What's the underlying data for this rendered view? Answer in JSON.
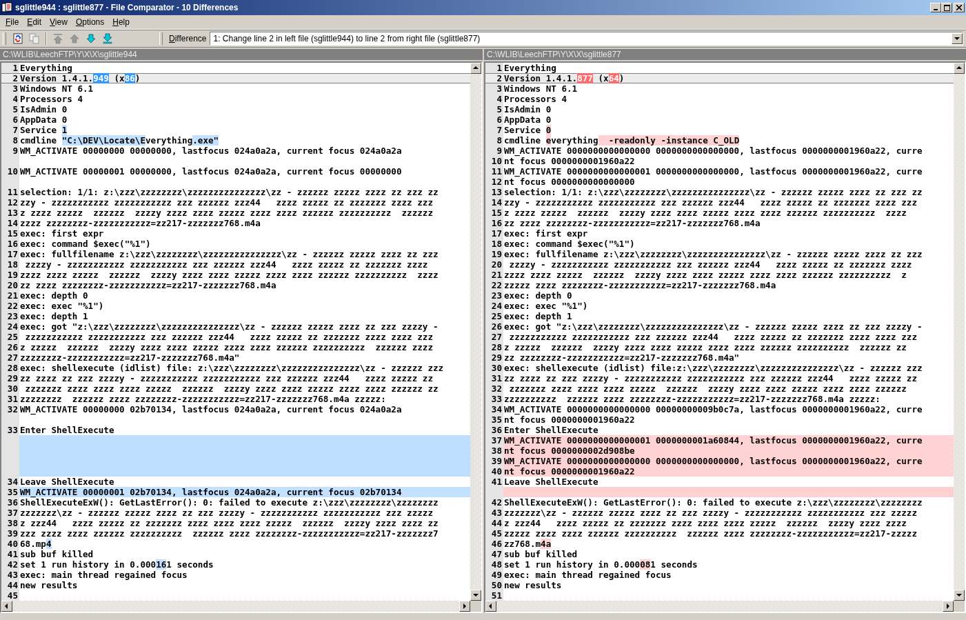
{
  "window": {
    "title": "sglittle944 : sglittle877 - File Comparator - 10 Differences"
  },
  "menu": [
    "File",
    "Edit",
    "View",
    "Options",
    "Help"
  ],
  "toolbar_buttons": [
    {
      "disabled": false
    },
    {
      "disabled": true
    },
    {
      "disabled": true
    },
    {
      "disabled": true
    },
    {
      "disabled": false
    },
    {
      "disabled": false
    }
  ],
  "difference": {
    "label": "Difference",
    "value": "1: Change line 2 in left file (sglittle944) to line 2 from right file (sglittle877)"
  },
  "panes": [
    {
      "color": "#3399ff",
      "path": "C:\\WLIB\\LeechFTP\\Y\\X\\X\\sglittle944",
      "rows": [
        {
          "kind": "line",
          "number": "1",
          "text": "Everything"
        },
        {
          "kind": "line",
          "number": "2",
          "current": true,
          "parts": [
            {
              "text": "Version 1.4.1."
            },
            {
              "text": "949",
              "changed": true
            },
            {
              "text": " (x"
            },
            {
              "text": "86",
              "changed": true
            },
            {
              "text": ")"
            }
          ]
        },
        {
          "kind": "line",
          "number": "3",
          "text": "Windows NT 6.1"
        },
        {
          "kind": "line",
          "number": "4",
          "text": "Processors 4"
        },
        {
          "kind": "line",
          "number": "5",
          "text": "IsAdmin 0"
        },
        {
          "kind": "line",
          "number": "6",
          "text": "AppData 0"
        },
        {
          "kind": "line",
          "number": "7",
          "parts": [
            {
              "text": "Service "
            },
            {
              "text": "1",
              "changed": true
            }
          ]
        },
        {
          "kind": "line",
          "number": "8",
          "parts": [
            {
              "text": "cmdline "
            },
            {
              "text": "\"C:\\DEV\\Locate\\E",
              "changed": true
            },
            {
              "text": "verything"
            },
            {
              "text": ".exe\"",
              "changed": true
            }
          ]
        },
        {
          "kind": "line",
          "number": "9",
          "text": "WM_ACTIVATE 00000000 00000000, lastfocus 024a0a2a, current focus 024a0a2a"
        },
        {
          "kind": "blank"
        },
        {
          "kind": "line",
          "number": "10",
          "text": "WM_ACTIVATE 00000001 00000000, lastfocus 024a0a2a, current focus 00000000"
        },
        {
          "kind": "blank"
        },
        {
          "kind": "line",
          "number": "11",
          "text": "selection: 1/1: z:\\zzz\\zzzzzzzz\\zzzzzzzzzzzzzzz\\zz - zzzzzz zzzzz zzzz zz zzz zz"
        },
        {
          "kind": "line",
          "number": "12",
          "text": "zzy - zzzzzzzzzzz zzzzzzzzzzz zzz zzzzzz zzz44   zzzz zzzzz zz zzzzzzz zzzz zzz"
        },
        {
          "kind": "line",
          "number": "13",
          "text": "z zzzz zzzzz  zzzzzz  zzzzy zzzz zzzz zzzzz zzzz zzzz zzzzzz zzzzzzzzzz  zzzzzz"
        },
        {
          "kind": "line",
          "number": "14",
          "text": "zzzz zzzzzzzz-zzzzzzzzzzz=zz217-zzzzzzz768.m4a"
        },
        {
          "kind": "line",
          "number": "15",
          "text": "exec: first expr"
        },
        {
          "kind": "line",
          "number": "16",
          "text": "exec: command $exec(\"%1\")"
        },
        {
          "kind": "line",
          "number": "17",
          "text": "exec: fullfilename z:\\zzz\\zzzzzzzz\\zzzzzzzzzzzzzzz\\zz - zzzzzz zzzzz zzzz zz zzz"
        },
        {
          "kind": "line",
          "number": "18",
          "text": " zzzzy - zzzzzzzzzzz zzzzzzzzzzz zzz zzzzzz zzz44   zzzz zzzzz zz zzzzzzz zzzz"
        },
        {
          "kind": "line",
          "number": "19",
          "text": "zzzz zzzz zzzzz  zzzzzz  zzzzy zzzz zzzz zzzzz zzzz zzzz zzzzzz zzzzzzzzzz  zzzz"
        },
        {
          "kind": "line",
          "number": "20",
          "text": "zz zzzz zzzzzzzz-zzzzzzzzzzz=zz217-zzzzzzz768.m4a"
        },
        {
          "kind": "line",
          "number": "21",
          "text": "exec: depth 0"
        },
        {
          "kind": "line",
          "number": "22",
          "text": "exec: exec \"%1\")"
        },
        {
          "kind": "line",
          "number": "23",
          "text": "exec: depth 1"
        },
        {
          "kind": "line",
          "number": "24",
          "text": "exec: got \"z:\\zzz\\zzzzzzzz\\zzzzzzzzzzzzzzz\\zz - zzzzzz zzzzz zzzz zz zzz zzzzy -"
        },
        {
          "kind": "line",
          "number": "25",
          "text": " zzzzzzzzzzz zzzzzzzzzzz zzz zzzzzz zzz44   zzzz zzzzz zz zzzzzzz zzzz zzzz zzz"
        },
        {
          "kind": "line",
          "number": "26",
          "text": "z zzzzz  zzzzzz  zzzzy zzzz zzzz zzzzz zzzz zzzz zzzzzz zzzzzzzzzz  zzzzzz zzzz"
        },
        {
          "kind": "line",
          "number": "27",
          "text": "zzzzzzzz-zzzzzzzzzzz=zz217-zzzzzzz768.m4a\""
        },
        {
          "kind": "line",
          "number": "28",
          "text": "exec: shellexecute (idlist) file: z:\\zzz\\zzzzzzzz\\zzzzzzzzzzzzzzz\\zz - zzzzzz zzz"
        },
        {
          "kind": "line",
          "number": "29",
          "text": "zz zzzz zz zzz zzzzy - zzzzzzzzzzz zzzzzzzzzzz zzz zzzzzz zzz44   zzzz zzzzz zz"
        },
        {
          "kind": "line",
          "number": "30",
          "text": " zzzzzzz zzzz zzzz zzzz zzzzz  zzzzzz  zzzzy zzzz zzzz zzzzz zzzz zzzz zzzzzz zz"
        },
        {
          "kind": "line",
          "number": "31",
          "text": "zzzzzzzz  zzzzzz zzzz zzzzzzzz-zzzzzzzzzzz=zz217-zzzzzzz768.m4a zzzzz:"
        },
        {
          "kind": "line",
          "number": "32",
          "text": "WM_ACTIVATE 00000000 02b70134, lastfocus 024a0a2a, current focus 024a0a2a"
        },
        {
          "kind": "blank"
        },
        {
          "kind": "line",
          "number": "33",
          "text": "Enter ShellExecute"
        },
        {
          "kind": "gap"
        },
        {
          "kind": "gap"
        },
        {
          "kind": "gap"
        },
        {
          "kind": "gap"
        },
        {
          "kind": "line",
          "number": "34",
          "text": "Leave ShellExecute"
        },
        {
          "kind": "line",
          "number": "35",
          "changed": true,
          "text": "WM_ACTIVATE 00000001 02b70134, lastfocus 024a0a2a, current focus 02b70134"
        },
        {
          "kind": "line",
          "number": "36",
          "text": "ShellExecuteExW(): GetLastError(): 0: failed to execute z:\\zzz\\zzzzzzzz\\zzzzzzzz"
        },
        {
          "kind": "line",
          "number": "37",
          "text": "zzzzzzz\\zz - zzzzzz zzzzz zzzz zz zzz zzzzy - zzzzzzzzzzz zzzzzzzzzzz zzz zzzzz"
        },
        {
          "kind": "line",
          "number": "38",
          "text": "z zzz44   zzzz zzzzz zz zzzzzzz zzzz zzzz zzzz zzzzz  zzzzzz  zzzzy zzzz zzzz zz"
        },
        {
          "kind": "line",
          "number": "39",
          "text": "zzz zzzz zzzz zzzzzz zzzzzzzzzz  zzzzzz zzzz zzzzzzzz-zzzzzzzzzzz=zz217-zzzzzzz7"
        },
        {
          "kind": "line",
          "number": "40",
          "parts": [
            {
              "text": "68.mp"
            },
            {
              "text": "4",
              "changed": true
            }
          ]
        },
        {
          "kind": "line",
          "number": "41",
          "text": "sub buf killed"
        },
        {
          "kind": "line",
          "number": "42",
          "parts": [
            {
              "text": "set 1 run history in 0.000"
            },
            {
              "text": "16",
              "changed": true
            },
            {
              "text": "1 seconds"
            }
          ]
        },
        {
          "kind": "line",
          "number": "43",
          "text": "exec: main thread regained focus"
        },
        {
          "kind": "line",
          "number": "44",
          "text": "new results"
        },
        {
          "kind": "line",
          "number": "45"
        }
      ]
    },
    {
      "color": "#ff6b6b",
      "path": "C:\\WLIB\\LeechFTP\\Y\\X\\X\\sglittle877",
      "rows": [
        {
          "kind": "line",
          "number": "1",
          "text": "Everything"
        },
        {
          "kind": "line",
          "number": "2",
          "current": true,
          "parts": [
            {
              "text": "Version 1.4.1."
            },
            {
              "text": "877",
              "changed": true
            },
            {
              "text": " (x"
            },
            {
              "text": "64",
              "changed": true
            },
            {
              "text": ")"
            }
          ]
        },
        {
          "kind": "line",
          "number": "3",
          "text": "Windows NT 6.1"
        },
        {
          "kind": "line",
          "number": "4",
          "text": "Processors 4"
        },
        {
          "kind": "line",
          "number": "5",
          "text": "IsAdmin 0"
        },
        {
          "kind": "line",
          "number": "6",
          "text": "AppData 0"
        },
        {
          "kind": "line",
          "number": "7",
          "parts": [
            {
              "text": "Service "
            },
            {
              "text": "0",
              "changed": true
            }
          ]
        },
        {
          "kind": "line",
          "number": "8",
          "parts": [
            {
              "text": "cmdline "
            },
            {
              "text": "e",
              "changed": true
            },
            {
              "text": "verything"
            },
            {
              "text": "  -readonly -instance C_OLD",
              "changed": true
            }
          ]
        },
        {
          "kind": "line",
          "number": "9",
          "text": "WM_ACTIVATE 0000000000000000 0000000000000000, lastfocus 0000000001960a22, curre"
        },
        {
          "kind": "line",
          "number": "10",
          "text": "nt focus 0000000001960a22"
        },
        {
          "kind": "line",
          "number": "11",
          "text": "WM_ACTIVATE 0000000000000001 0000000000000000, lastfocus 0000000001960a22, curre"
        },
        {
          "kind": "line",
          "number": "12",
          "text": "nt focus 0000000000000000"
        },
        {
          "kind": "line",
          "number": "13",
          "text": "selection: 1/1: z:\\zzz\\zzzzzzzz\\zzzzzzzzzzzzzzz\\zz - zzzzzz zzzzz zzzz zz zzz zz"
        },
        {
          "kind": "line",
          "number": "14",
          "text": "zzy - zzzzzzzzzzz zzzzzzzzzzz zzz zzzzzz zzz44   zzzz zzzzz zz zzzzzzz zzzz zzz"
        },
        {
          "kind": "line",
          "number": "15",
          "text": "z zzzz zzzzz  zzzzzz  zzzzy zzzz zzzz zzzzz zzzz zzzz zzzzzz zzzzzzzzzz  zzzz"
        },
        {
          "kind": "line",
          "number": "16",
          "text": "zz zzzz zzzzzzzz-zzzzzzzzzzz=zz217-zzzzzzz768.m4a"
        },
        {
          "kind": "line",
          "number": "17",
          "text": "exec: first expr"
        },
        {
          "kind": "line",
          "number": "18",
          "text": "exec: command $exec(\"%1\")"
        },
        {
          "kind": "line",
          "number": "19",
          "text": "exec: fullfilename z:\\zzz\\zzzzzzzz\\zzzzzzzzzzzzzzz\\zz - zzzzzz zzzzz zzzz zz zzz"
        },
        {
          "kind": "line",
          "number": "20",
          "text": " zzzzy - zzzzzzzzzzz zzzzzzzzzzz zzz zzzzzz zzz44   zzzz zzzzz zz zzzzzzz zzzz"
        },
        {
          "kind": "line",
          "number": "21",
          "text": "zzzz zzzz zzzzz  zzzzzz  zzzzy zzzz zzzz zzzzz zzzz zzzz zzzzzz zzzzzzzzzz  z"
        },
        {
          "kind": "line",
          "number": "22",
          "text": "zzzzz zzzz zzzzzzzz-zzzzzzzzzzz=zz217-zzzzzzz768.m4a"
        },
        {
          "kind": "line",
          "number": "23",
          "text": "exec: depth 0"
        },
        {
          "kind": "line",
          "number": "24",
          "text": "exec: exec \"%1\")"
        },
        {
          "kind": "line",
          "number": "25",
          "text": "exec: depth 1"
        },
        {
          "kind": "line",
          "number": "26",
          "text": "exec: got \"z:\\zzz\\zzzzzzzz\\zzzzzzzzzzzzzzz\\zz - zzzzzz zzzzz zzzz zz zzz zzzzy -"
        },
        {
          "kind": "line",
          "number": "27",
          "text": " zzzzzzzzzzz zzzzzzzzzzz zzz zzzzzz zzz44   zzzz zzzzz zz zzzzzzz zzzz zzzz zzz"
        },
        {
          "kind": "line",
          "number": "28",
          "text": "z zzzzz  zzzzzz  zzzzy zzzz zzzz zzzzz zzzz zzzz zzzzzz zzzzzzzzzz  zzzzzz zz"
        },
        {
          "kind": "line",
          "number": "29",
          "text": "zz zzzzzzzz-zzzzzzzzzzz=zz217-zzzzzzz768.m4a\""
        },
        {
          "kind": "line",
          "number": "30",
          "text": "exec: shellexecute (idlist) file:z:\\zzz\\zzzzzzzz\\zzzzzzzzzzzzzzz\\zz - zzzzzz zzz"
        },
        {
          "kind": "line",
          "number": "31",
          "text": "zz zzzz zz zzz zzzzy - zzzzzzzzzzz zzzzzzzzzzz zzz zzzzzz zzz44   zzzz zzzzz zz"
        },
        {
          "kind": "line",
          "number": "32",
          "text": " zzzzzzz zzzz zzzz zzzz zzzzz  zzzzzz  zzzzy zzzz zzzz zzzzz zzzz zzzz zzzzzz"
        },
        {
          "kind": "line",
          "number": "33",
          "text": "zzzzzzzzzz  zzzzzz zzzz zzzzzzzz-zzzzzzzzzzz=zz217-zzzzzzz768.m4a zzzzz:"
        },
        {
          "kind": "line",
          "number": "34",
          "text": "WM_ACTIVATE 0000000000000000 00000000009b0c7a, lastfocus 0000000001960a22, curre"
        },
        {
          "kind": "line",
          "number": "35",
          "text": "nt focus 0000000001960a22"
        },
        {
          "kind": "line",
          "number": "36",
          "text": "Enter ShellExecute"
        },
        {
          "kind": "line",
          "number": "37",
          "changed": true,
          "text": "WM_ACTIVATE 0000000000000001 0000000001a60844, lastfocus 0000000001960a22, curre"
        },
        {
          "kind": "line",
          "number": "38",
          "changed": true,
          "text": "nt focus 0000000002d908be"
        },
        {
          "kind": "line",
          "number": "39",
          "changed": true,
          "text": "WM_ACTIVATE 0000000000000000 0000000000000000, lastfocus 0000000001960a22, curre"
        },
        {
          "kind": "line",
          "number": "40",
          "changed": true,
          "text": "nt focus 0000000001960a22"
        },
        {
          "kind": "line",
          "number": "41",
          "text": "Leave ShellExecute"
        },
        {
          "kind": "gap"
        },
        {
          "kind": "line",
          "number": "42",
          "text": "ShellExecuteExW(): GetLastError(): 0: failed to execute z:\\zzz\\zzzzzzzz\\zzzzzzzz"
        },
        {
          "kind": "line",
          "number": "43",
          "text": "zzzzzzz\\zz - zzzzzz zzzzz zzzz zz zzz zzzzy - zzzzzzzzzzz zzzzzzzzzzz zzz zzzzz"
        },
        {
          "kind": "line",
          "number": "44",
          "text": "z zzz44   zzzz zzzzz zz zzzzzzz zzzz zzzz zzzz zzzzz  zzzzzz  zzzzy zzzz zzzz"
        },
        {
          "kind": "line",
          "number": "45",
          "text": "zzzzz zzzz zzzz zzzzzz zzzzzzzzzz  zzzzzz zzzz zzzzzzzz-zzzzzzzzzzz=zz217-zzzzz"
        },
        {
          "kind": "line",
          "number": "46",
          "parts": [
            {
              "text": "zz768.m"
            },
            {
              "text": "4a",
              "changed": true
            }
          ]
        },
        {
          "kind": "line",
          "number": "47",
          "text": "sub buf killed"
        },
        {
          "kind": "line",
          "number": "48",
          "parts": [
            {
              "text": "set 1 run history in 0.000"
            },
            {
              "text": "08",
              "changed": true
            },
            {
              "text": "1 seconds"
            }
          ]
        },
        {
          "kind": "line",
          "number": "49",
          "text": "exec: main thread regained focus"
        },
        {
          "kind": "line",
          "number": "50",
          "text": "new results"
        },
        {
          "kind": "line",
          "number": "51"
        }
      ]
    }
  ]
}
